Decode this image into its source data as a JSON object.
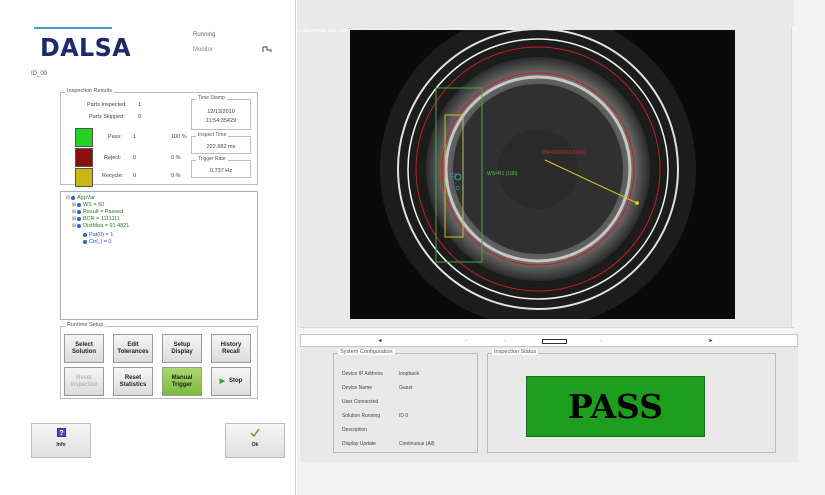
{
  "brand": {
    "logo_text": "DALSA"
  },
  "header": {
    "status": "Running",
    "mode": "Monitor",
    "solution_label": "ID_00"
  },
  "results": {
    "group_title": "Inspection Results",
    "parts_inspected_label": "Parts Inspected:",
    "parts_inspected_value": "1",
    "parts_skipped_label": "Parts Skipped:",
    "parts_skipped_value": "0",
    "rows": [
      {
        "label": "Pass:",
        "count": "1",
        "percent": "100 %",
        "color": "#22d222"
      },
      {
        "label": "Reject:",
        "count": "0",
        "percent": "0 %",
        "color": "#8a1010"
      },
      {
        "label": "Recycle:",
        "count": "0",
        "percent": "0 %",
        "color": "#c9b716"
      }
    ],
    "time_stamp": {
      "title": "Time Stamp",
      "date": "12/13/2010",
      "time": "11:54:35429"
    },
    "inspect_time": {
      "title": "Inspect Time",
      "value": "222.682 ms"
    },
    "trigger_rate": {
      "title": "Trigger Rate",
      "value": "0.737 Hz"
    }
  },
  "tree": {
    "items": [
      {
        "exp": "⊟",
        "text": "AppVar"
      },
      {
        "exp": "⊞",
        "text": "WS = 50"
      },
      {
        "exp": "⊞",
        "text": "Result = Passed"
      },
      {
        "exp": "⊞",
        "text": "BCR = 1111111"
      },
      {
        "exp": "⊞",
        "text": "DistMea = 91.4821"
      },
      {
        "exp": "",
        "text": "Pat(0) = 1"
      },
      {
        "exp": "",
        "text": "Ctrl_I = 0"
      }
    ]
  },
  "runtime": {
    "group_title": "Runtime Setup",
    "buttons": [
      {
        "label1": "Select",
        "label2": "Solution"
      },
      {
        "label1": "Edit",
        "label2": "Tolerances"
      },
      {
        "label1": "Setup",
        "label2": "Display"
      },
      {
        "label1": "History",
        "label2": "Recall"
      },
      {
        "label1": "Reset",
        "label2": "Inspection"
      },
      {
        "label1": "Reset",
        "label2": "Statistics"
      },
      {
        "label1": "Manual",
        "label2": "Trigger"
      },
      {
        "label1": "Stop",
        "label2": ""
      }
    ]
  },
  "footer": {
    "info_label": "Info",
    "ok_label": "Ok"
  },
  "image": {
    "title": "c:\\documents and settings\\all users\\application data\\ipd\\vsa\\projects\\ci\\a1\\pm\\vision\\apps\\fdr\\smdi",
    "overlay_ws": "WS=R1 (100)",
    "overlay_ds": "DS=XXXXXXXXXX",
    "overlay_c1": "C1",
    "overlay_d1": "D 1"
  },
  "system_config": {
    "title": "System Configuration",
    "rows": [
      {
        "k": "Device IP Address",
        "v": "loopback"
      },
      {
        "k": "Device Name",
        "v": "Guest"
      },
      {
        "k": "User Connected",
        "v": ""
      },
      {
        "k": "Solution Running",
        "v": "ID 0"
      },
      {
        "k": "Description",
        "v": ""
      },
      {
        "k": "Display Update",
        "v": "Continuous (All)"
      }
    ]
  },
  "inspection_status": {
    "title": "Inspection Status",
    "result": "PASS"
  }
}
